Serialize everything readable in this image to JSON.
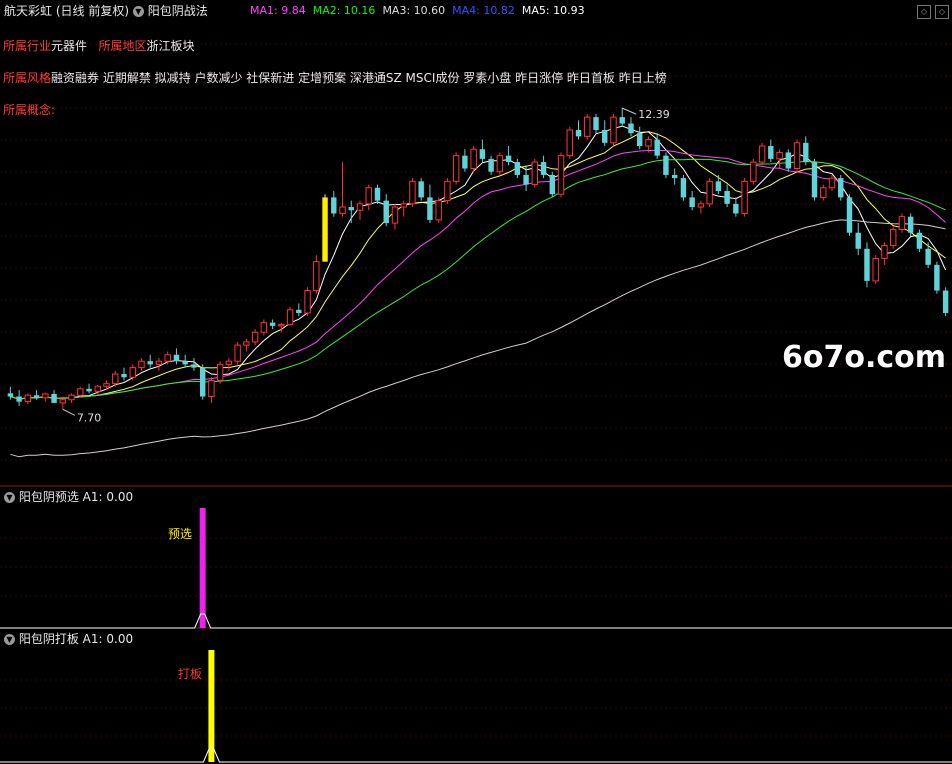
{
  "header": {
    "stock_name": "航天彩虹",
    "period": "(日线 前复权)",
    "strategy": "阳包阴战法",
    "ma": [
      {
        "label": "MA1: 9.84",
        "color": "#ff44ff"
      },
      {
        "label": "MA2: 10.16",
        "color": "#00ff00"
      },
      {
        "label": "MA3: 10.60",
        "color": "#dddddd"
      },
      {
        "label": "MA4: 10.82",
        "color": "#3355ff"
      },
      {
        "label": "MA5: 10.93",
        "color": "#ffffff"
      }
    ]
  },
  "info": {
    "industry_label": "所属行业",
    "industry_value": "元器件",
    "region_label": "所属地区",
    "region_value": "浙江板块",
    "style_label": "所属风格",
    "style_value": "融资融券 近期解禁 拟减持 户数减少 社保新进 定增预案 深港通SZ MSCI成份 罗素小盘 昨日涨停 昨日首板 昨日上榜",
    "concept_label": "所属概念:"
  },
  "watermark": "6o7o.com",
  "panel2": {
    "title": "阳包阴预选",
    "value": "A1: 0.00",
    "signal_label": "预选"
  },
  "panel3": {
    "title": "阳包阴打板",
    "value": "A1: 0.00",
    "signal_label": "打板"
  },
  "chart_data": {
    "type": "candlestick",
    "ylim": [
      6.6,
      13.7
    ],
    "high_annotation": "12.39",
    "low_annotation": "7.70",
    "colors": {
      "up": "#ff3333",
      "down": "#5fd3d8",
      "limit_up": "#ffee00"
    },
    "candles": [
      [
        7.95,
        8.05,
        7.85,
        7.9
      ],
      [
        7.9,
        8.0,
        7.75,
        7.82
      ],
      [
        7.82,
        7.95,
        7.78,
        7.92
      ],
      [
        7.92,
        8.0,
        7.85,
        7.88
      ],
      [
        7.88,
        7.96,
        7.82,
        7.94
      ],
      [
        7.94,
        8.0,
        7.85,
        7.8
      ],
      [
        7.8,
        7.9,
        7.7,
        7.85
      ],
      [
        7.85,
        7.95,
        7.8,
        7.92
      ],
      [
        7.92,
        8.05,
        7.88,
        8.02
      ],
      [
        8.02,
        8.1,
        7.95,
        7.98
      ],
      [
        7.98,
        8.08,
        7.92,
        8.06
      ],
      [
        8.06,
        8.15,
        8.0,
        8.1
      ],
      [
        8.1,
        8.3,
        8.05,
        8.25
      ],
      [
        8.25,
        8.35,
        8.15,
        8.2
      ],
      [
        8.2,
        8.4,
        8.15,
        8.35
      ],
      [
        8.35,
        8.5,
        8.3,
        8.45
      ],
      [
        8.45,
        8.55,
        8.35,
        8.4
      ],
      [
        8.4,
        8.5,
        8.3,
        8.45
      ],
      [
        8.45,
        8.6,
        8.4,
        8.55
      ],
      [
        8.55,
        8.65,
        8.4,
        8.45
      ],
      [
        8.45,
        8.55,
        8.35,
        8.4
      ],
      [
        8.4,
        8.5,
        8.3,
        8.35
      ],
      [
        8.35,
        8.4,
        7.85,
        7.9
      ],
      [
        7.9,
        8.2,
        7.8,
        8.15
      ],
      [
        8.15,
        8.45,
        8.1,
        8.4
      ],
      [
        8.4,
        8.5,
        8.3,
        8.45
      ],
      [
        8.45,
        8.75,
        8.4,
        8.7
      ],
      [
        8.7,
        8.8,
        8.6,
        8.75
      ],
      [
        8.75,
        8.95,
        8.7,
        8.9
      ],
      [
        8.9,
        9.1,
        8.85,
        9.05
      ],
      [
        9.05,
        9.1,
        8.95,
        9.0
      ],
      [
        9.0,
        9.05,
        8.9,
        9.02
      ],
      [
        9.02,
        9.3,
        9.0,
        9.25
      ],
      [
        9.25,
        9.35,
        9.15,
        9.2
      ],
      [
        9.2,
        9.6,
        9.15,
        9.55
      ],
      [
        9.55,
        10.1,
        9.5,
        10.0
      ],
      [
        10.0,
        11.05,
        10.0,
        11.0
      ],
      [
        11.0,
        11.1,
        10.7,
        10.75
      ],
      [
        10.75,
        11.55,
        10.7,
        10.85
      ],
      [
        10.85,
        10.95,
        10.6,
        10.8
      ],
      [
        10.8,
        10.95,
        10.65,
        10.9
      ],
      [
        10.9,
        11.2,
        10.8,
        11.15
      ],
      [
        11.15,
        11.2,
        10.9,
        10.95
      ],
      [
        10.95,
        11.05,
        10.55,
        10.6
      ],
      [
        10.6,
        10.9,
        10.5,
        10.85
      ],
      [
        10.85,
        10.95,
        10.7,
        10.9
      ],
      [
        10.9,
        11.3,
        10.85,
        11.25
      ],
      [
        11.25,
        11.3,
        10.95,
        11.0
      ],
      [
        11.0,
        11.2,
        10.6,
        10.65
      ],
      [
        10.65,
        11.0,
        10.6,
        10.95
      ],
      [
        10.95,
        11.3,
        10.9,
        11.25
      ],
      [
        11.25,
        11.7,
        11.2,
        11.65
      ],
      [
        11.65,
        11.75,
        11.4,
        11.45
      ],
      [
        11.45,
        11.8,
        11.4,
        11.75
      ],
      [
        11.75,
        11.9,
        11.55,
        11.6
      ],
      [
        11.6,
        11.65,
        11.35,
        11.4
      ],
      [
        11.4,
        11.7,
        11.35,
        11.65
      ],
      [
        11.65,
        11.8,
        11.5,
        11.55
      ],
      [
        11.55,
        11.6,
        11.3,
        11.35
      ],
      [
        11.35,
        11.5,
        11.1,
        11.2
      ],
      [
        11.2,
        11.6,
        11.15,
        11.55
      ],
      [
        11.55,
        11.65,
        11.3,
        11.35
      ],
      [
        11.35,
        11.4,
        11.0,
        11.05
      ],
      [
        11.05,
        11.7,
        11.0,
        11.65
      ],
      [
        11.65,
        12.1,
        11.6,
        12.05
      ],
      [
        12.05,
        12.2,
        11.9,
        11.95
      ],
      [
        11.95,
        12.3,
        11.9,
        12.25
      ],
      [
        12.25,
        12.3,
        12.0,
        12.05
      ],
      [
        12.05,
        12.2,
        11.8,
        11.85
      ],
      [
        11.85,
        12.3,
        11.8,
        12.25
      ],
      [
        12.25,
        12.39,
        12.1,
        12.15
      ],
      [
        12.15,
        12.25,
        11.95,
        12.0
      ],
      [
        12.0,
        12.1,
        11.75,
        11.8
      ],
      [
        11.8,
        11.95,
        11.7,
        11.9
      ],
      [
        11.9,
        12.0,
        11.6,
        11.65
      ],
      [
        11.65,
        11.7,
        11.3,
        11.35
      ],
      [
        11.35,
        11.45,
        11.2,
        11.3
      ],
      [
        11.3,
        11.35,
        10.95,
        11.0
      ],
      [
        11.0,
        11.1,
        10.8,
        10.85
      ],
      [
        10.85,
        10.95,
        10.75,
        10.9
      ],
      [
        10.9,
        11.3,
        10.85,
        11.25
      ],
      [
        11.25,
        11.35,
        11.05,
        11.1
      ],
      [
        11.1,
        11.2,
        10.85,
        10.9
      ],
      [
        10.9,
        11.0,
        10.7,
        10.75
      ],
      [
        10.75,
        11.3,
        10.7,
        11.25
      ],
      [
        11.25,
        11.6,
        11.2,
        11.55
      ],
      [
        11.55,
        11.85,
        11.5,
        11.8
      ],
      [
        11.8,
        11.9,
        11.55,
        11.6
      ],
      [
        11.6,
        11.75,
        11.45,
        11.7
      ],
      [
        11.7,
        11.75,
        11.4,
        11.45
      ],
      [
        11.45,
        11.9,
        11.4,
        11.85
      ],
      [
        11.85,
        11.95,
        11.5,
        11.55
      ],
      [
        11.55,
        11.6,
        10.95,
        11.0
      ],
      [
        11.0,
        11.2,
        10.95,
        11.15
      ],
      [
        11.15,
        11.35,
        11.1,
        11.3
      ],
      [
        11.3,
        11.35,
        10.95,
        11.0
      ],
      [
        11.0,
        11.05,
        10.4,
        10.45
      ],
      [
        10.45,
        10.6,
        10.1,
        10.2
      ],
      [
        10.2,
        10.3,
        9.6,
        9.7
      ],
      [
        9.7,
        10.1,
        9.65,
        10.05
      ],
      [
        10.05,
        10.3,
        9.95,
        10.25
      ],
      [
        10.25,
        10.55,
        10.2,
        10.5
      ],
      [
        10.5,
        10.75,
        10.45,
        10.7
      ],
      [
        10.7,
        10.75,
        10.4,
        10.45
      ],
      [
        10.45,
        10.5,
        10.15,
        10.2
      ],
      [
        10.2,
        10.3,
        9.9,
        9.95
      ],
      [
        9.95,
        10.0,
        9.5,
        9.55
      ],
      [
        9.55,
        9.6,
        9.15,
        9.2
      ]
    ],
    "limit_up_index": 36,
    "ma_series": [
      {
        "name": "MA1",
        "period": 5,
        "color": "#ffffff"
      },
      {
        "name": "MA2",
        "period": 10,
        "color": "#ffff55"
      },
      {
        "name": "MA3",
        "period": 20,
        "color": "#ff44ff"
      },
      {
        "name": "MA4",
        "period": 30,
        "color": "#33ee33"
      },
      {
        "name": "MA5",
        "period": 60,
        "color": "#cfcfcf"
      }
    ],
    "signal_panel1": {
      "index": 22,
      "peak": 1,
      "color": "#ee22ee"
    },
    "signal_panel2": {
      "index": 23,
      "peak": 1,
      "color": "#ffff00"
    }
  }
}
